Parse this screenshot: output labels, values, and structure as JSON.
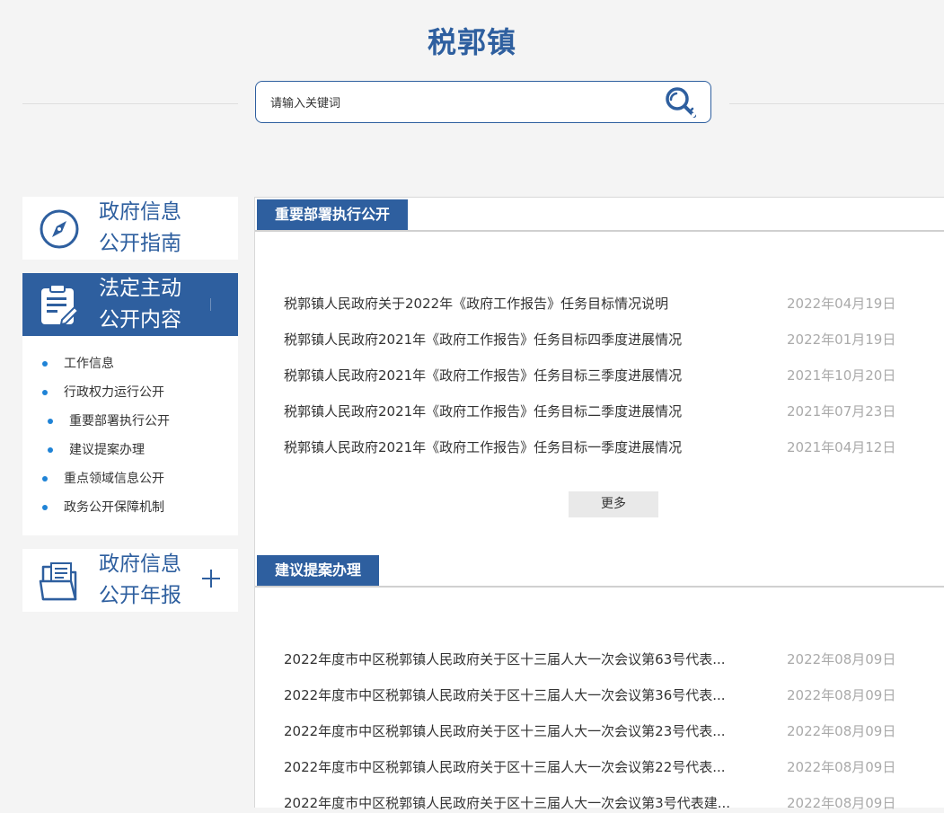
{
  "header": {
    "title": "税郭镇",
    "search_placeholder": "请输入关键词"
  },
  "sidebar": {
    "guide": {
      "line1": "政府信息",
      "line2": "公开指南"
    },
    "active": {
      "line1": "法定主动",
      "line2": "公开内容"
    },
    "sub_items": [
      {
        "label": "工作信息"
      },
      {
        "label": "行政权力运行公开"
      },
      {
        "label": "重要部署执行公开"
      },
      {
        "label": "建议提案办理"
      },
      {
        "label": "重点领域信息公开"
      },
      {
        "label": "政务公开保障机制"
      }
    ],
    "report": {
      "line1": "政府信息",
      "line2": "公开年报"
    }
  },
  "sections": [
    {
      "title": "重要部署执行公开",
      "items": [
        {
          "title": "税郭镇人民政府关于2022年《政府工作报告》任务目标情况说明",
          "date": "2022年04月19日"
        },
        {
          "title": "税郭镇人民政府2021年《政府工作报告》任务目标四季度进展情况",
          "date": "2022年01月19日"
        },
        {
          "title": "税郭镇人民政府2021年《政府工作报告》任务目标三季度进展情况",
          "date": "2021年10月20日"
        },
        {
          "title": "税郭镇人民政府2021年《政府工作报告》任务目标二季度进展情况",
          "date": "2021年07月23日"
        },
        {
          "title": "税郭镇人民政府2021年《政府工作报告》任务目标一季度进展情况",
          "date": "2021年04月12日"
        }
      ],
      "more_label": "更多"
    },
    {
      "title": "建议提案办理",
      "items": [
        {
          "title": "2022年度市中区税郭镇人民政府关于区十三届人大一次会议第63号代表...",
          "date": "2022年08月09日"
        },
        {
          "title": "2022年度市中区税郭镇人民政府关于区十三届人大一次会议第36号代表...",
          "date": "2022年08月09日"
        },
        {
          "title": "2022年度市中区税郭镇人民政府关于区十三届人大一次会议第23号代表...",
          "date": "2022年08月09日"
        },
        {
          "title": "2022年度市中区税郭镇人民政府关于区十三届人大一次会议第22号代表...",
          "date": "2022年08月09日"
        },
        {
          "title": "2022年度市中区税郭镇人民政府关于区十三届人大一次会议第3号代表建...",
          "date": "2022年08月09日"
        }
      ]
    }
  ],
  "colors": {
    "brand_blue": "#2e5f9f",
    "bullet_blue": "#1f83d6",
    "date_gray": "#aaaaaa"
  },
  "icons": {
    "guide": "compass-icon",
    "active": "clipboard-edit-icon",
    "report": "folder-document-icon",
    "search": "search-key-icon",
    "expand": "plus-icon"
  }
}
